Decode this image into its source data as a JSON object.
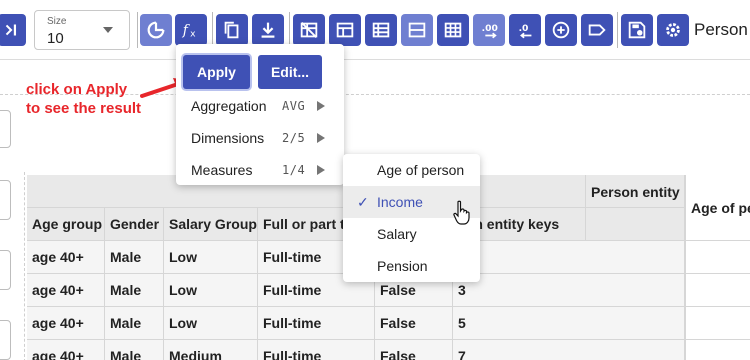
{
  "toolbar": {
    "size_label": "Size",
    "size_value": "10",
    "person_label": "Person",
    "icons": [
      "sidebar-toggle-icon",
      "chart-icon",
      "formula-icon",
      "copy-icon",
      "download-icon",
      "filter-off-icon",
      "layout-icon",
      "list-layout-icon",
      "compact-layout-icon",
      "grid-layout-icon",
      "decimals-more-icon",
      "decimals-less-icon",
      "add-circle-icon",
      "label-icon",
      "save-settings-icon",
      "settings-icon"
    ]
  },
  "annotation": {
    "text": "click on Apply\nto see the result",
    "color": "#e8262b"
  },
  "popup": {
    "apply_label": "Apply",
    "edit_label": "Edit...",
    "rows": [
      {
        "label": "Aggregation",
        "value": "AVG"
      },
      {
        "label": "Dimensions",
        "value": "2/5"
      },
      {
        "label": "Measures",
        "value": "1/4"
      }
    ]
  },
  "submenu": {
    "items": [
      {
        "label": "Age of person",
        "selected": false
      },
      {
        "label": "Income",
        "selected": true
      },
      {
        "label": "Salary",
        "selected": false
      },
      {
        "label": "Pension",
        "selected": false
      }
    ],
    "check_glyph": "✓"
  },
  "table": {
    "header_top": {
      "person_entity": "Person entity",
      "age_of_person": "Age of pe"
    },
    "columns": [
      "Age group",
      "Gender",
      "Salary Group",
      "Full or part t",
      "",
      "son entity keys"
    ],
    "rows": [
      [
        "age 40+",
        "Male",
        "Low",
        "Full-time",
        "",
        ""
      ],
      [
        "age 40+",
        "Male",
        "Low",
        "Full-time",
        "False",
        "3"
      ],
      [
        "age 40+",
        "Male",
        "Low",
        "Full-time",
        "False",
        "5"
      ],
      [
        "age 40+",
        "Male",
        "Medium",
        "Full-time",
        "False",
        "7"
      ]
    ]
  },
  "colors": {
    "accent": "#3f51b5",
    "accent_light": "#6f7fd1",
    "header_bg": "#e9e9e9",
    "row_bg": "#f5f5f5"
  }
}
